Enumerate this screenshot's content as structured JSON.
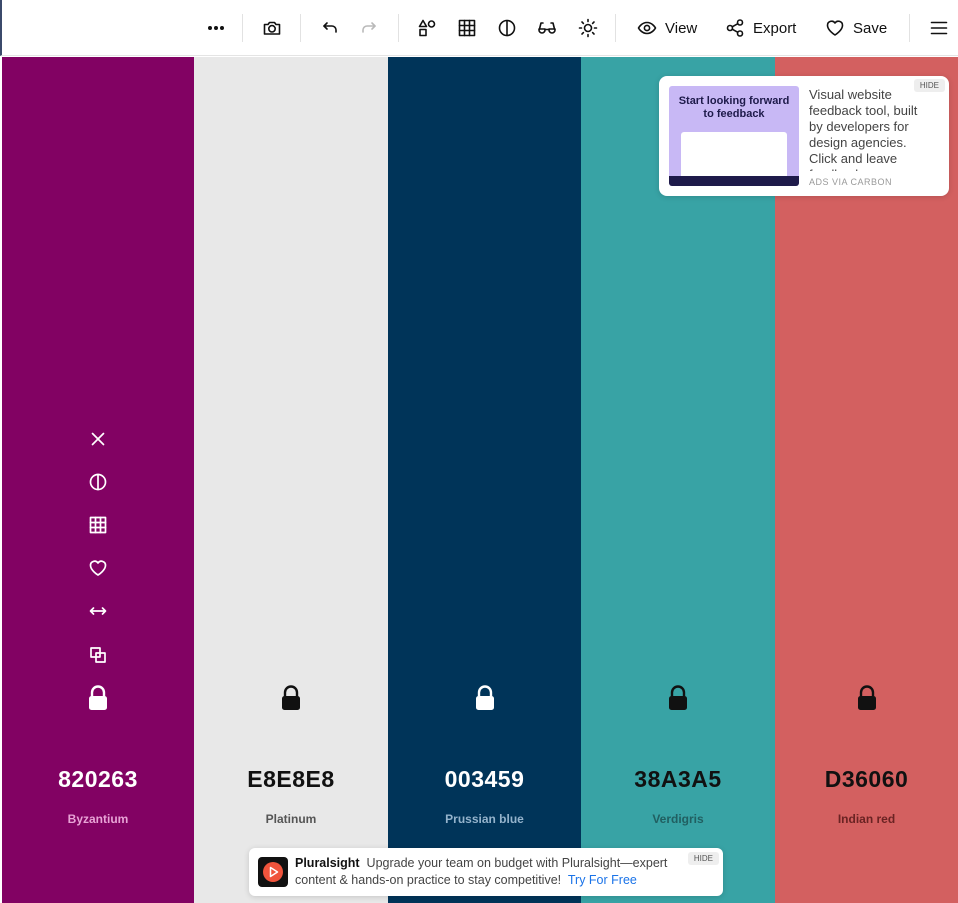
{
  "toolbar": {
    "view_label": "View",
    "export_label": "Export",
    "save_label": "Save"
  },
  "palette": [
    {
      "hex": "820263",
      "name": "Byzantium",
      "bg": "#820263",
      "text": "#ffffff",
      "name_color": "#e8a3d6",
      "locked": false
    },
    {
      "hex": "E8E8E8",
      "name": "Platinum",
      "bg": "#e8e8e8",
      "text": "#111111",
      "name_color": "#555555",
      "locked": true
    },
    {
      "hex": "003459",
      "name": "Prussian blue",
      "bg": "#003459",
      "text": "#ffffff",
      "name_color": "#94b3cc",
      "locked": true
    },
    {
      "hex": "38A3A5",
      "name": "Verdigris",
      "bg": "#38a3a5",
      "text": "#111111",
      "name_color": "#215f61",
      "locked": true
    },
    {
      "hex": "D36060",
      "name": "Indian red",
      "bg": "#d36060",
      "text": "#111111",
      "name_color": "#6a2323",
      "locked": true
    }
  ],
  "column_tools": [
    "close-icon",
    "contrast-icon",
    "shades-grid-icon",
    "heart-icon",
    "drag-arrows-icon",
    "copy-icon",
    "lock-icon"
  ],
  "ad": {
    "image_title": "Start looking forward to feedback",
    "text": "Visual website feedback tool, built by developers for design agencies. Click and leave feedback.",
    "via": "ADS VIA CARBON",
    "hide": "HIDE"
  },
  "promo": {
    "brand": "Pluralsight",
    "message": "Upgrade your team on budget with Pluralsight—expert content & hands-on practice to stay competitive!",
    "cta": "Try For Free",
    "hide": "HIDE"
  }
}
